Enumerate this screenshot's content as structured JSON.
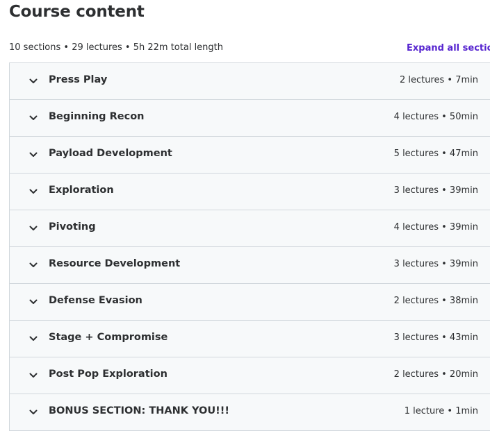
{
  "header": {
    "title": "Course content",
    "summary": "10 sections • 29 lectures • 5h 22m total length",
    "expand_label": "Expand all section"
  },
  "sections": [
    {
      "title": "Press Play",
      "info": "2 lectures • 7min"
    },
    {
      "title": "Beginning Recon",
      "info": "4 lectures • 50min"
    },
    {
      "title": "Payload Development",
      "info": "5 lectures • 47min"
    },
    {
      "title": "Exploration",
      "info": "3 lectures • 39min"
    },
    {
      "title": "Pivoting",
      "info": "4 lectures • 39min"
    },
    {
      "title": "Resource Development",
      "info": "3 lectures • 39min"
    },
    {
      "title": "Defense Evasion",
      "info": "2 lectures • 38min"
    },
    {
      "title": "Stage + Compromise",
      "info": "3 lectures • 43min"
    },
    {
      "title": "Post Pop Exploration",
      "info": "2 lectures • 20min"
    },
    {
      "title": "BONUS SECTION: THANK YOU!!!",
      "info": "1 lecture • 1min"
    }
  ],
  "icons": {
    "section_toggle": "chevron-down-icon"
  },
  "colors": {
    "text": "#2d2f31",
    "accent": "#5624d0",
    "section_bg": "#f7f9fa",
    "border": "#d1d7dc"
  }
}
